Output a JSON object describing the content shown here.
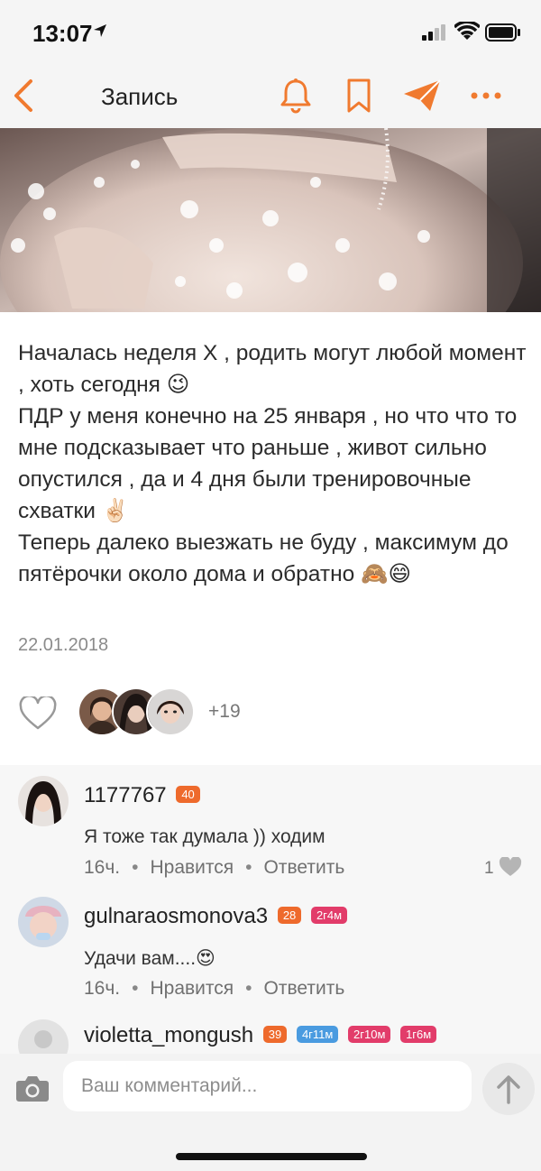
{
  "status": {
    "time": "13:07"
  },
  "nav": {
    "title": "Запись"
  },
  "post": {
    "text": "Началась неделя Х , родить могут любой момент , хоть сегодня 😉\nПДР у меня конечно на 25 января , но что что то мне подсказывает что раньше , живот сильно опустился , да и 4 дня были тренировочные схватки ✌🏻\nТеперь далеко выезжать не буду , максимум до пятёрочки около дома и обратно 🙈😄",
    "date": "22.01.2018",
    "likes_more": "+19"
  },
  "comments": [
    {
      "name": "1177767",
      "badges": [
        "40"
      ],
      "text": "Я тоже так думала )) ходим",
      "time": "16ч.",
      "like_label": "Нравится",
      "reply_label": "Ответить",
      "likes": "1"
    },
    {
      "name": "gulnaraosmonova3",
      "badges": [
        "28",
        "2г4м"
      ],
      "text": "Удачи вам....😍",
      "time": "16ч.",
      "like_label": "Нравится",
      "reply_label": "Ответить"
    },
    {
      "name": "violetta_mongush",
      "badges": [
        "39",
        "4г11м",
        "2г10м",
        "1г6м"
      ]
    }
  ],
  "input": {
    "placeholder": "Ваш комментарий..."
  },
  "colors": {
    "accent": "#f07a2f",
    "badge_orange": "#ee6a2c",
    "badge_pink": "#e23c6a",
    "badge_blue": "#4a9be0"
  }
}
